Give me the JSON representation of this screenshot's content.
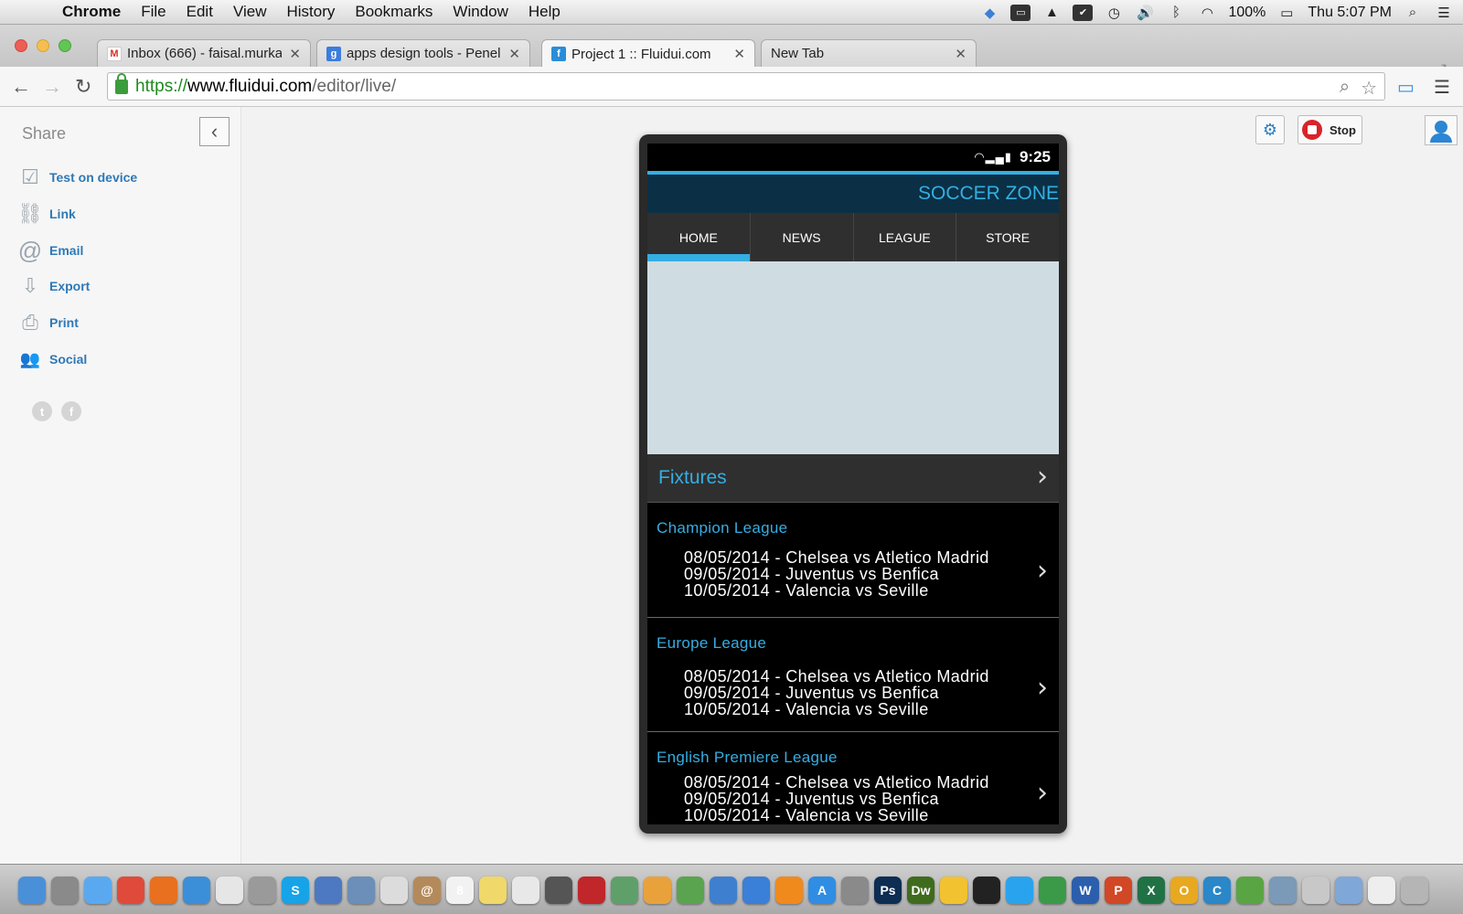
{
  "menubar": {
    "app_name": "Chrome",
    "menus": [
      "File",
      "Edit",
      "View",
      "History",
      "Bookmarks",
      "Window",
      "Help"
    ],
    "battery": "100%",
    "clock": "Thu 5:07 PM"
  },
  "tabs": [
    {
      "title": "Inbox (666) - faisal.murka",
      "favicon": "gmail-icon",
      "favicon_char": "M",
      "favicon_color": "#d93025"
    },
    {
      "title": "apps design tools - Penelu",
      "favicon": "google-icon",
      "favicon_char": "g",
      "favicon_color": "#3b7ddd"
    },
    {
      "title": "Project 1 :: Fluidui.com",
      "favicon": "fluidui-icon",
      "favicon_char": "f",
      "favicon_color": "#2a8dd8"
    },
    {
      "title": "New Tab",
      "favicon": "",
      "favicon_char": "",
      "favicon_color": ""
    }
  ],
  "address": {
    "scheme": "https://",
    "host": "www.fluidui.com",
    "path": "/editor/live/"
  },
  "share_panel": {
    "title": "Share",
    "items": [
      {
        "label": "Test on device",
        "icon": "checkbox-icon",
        "glyph": "☑"
      },
      {
        "label": "Link",
        "icon": "link-icon",
        "glyph": "⛓"
      },
      {
        "label": "Email",
        "icon": "at-icon",
        "glyph": "@"
      },
      {
        "label": "Export",
        "icon": "export-icon",
        "glyph": "⇩"
      },
      {
        "label": "Print",
        "icon": "printer-icon",
        "glyph": "⎙"
      },
      {
        "label": "Social",
        "icon": "people-icon",
        "glyph": "👥"
      }
    ],
    "social_twitter": "t",
    "social_facebook": "f"
  },
  "top_controls": {
    "stop_label": "Stop"
  },
  "phone": {
    "time": "9:25",
    "app_title": "SOCCER ZONE",
    "tabs": [
      "HOME",
      "NEWS",
      "LEAGUE",
      "STORE"
    ],
    "active_tab": "HOME",
    "fixtures_label": "Fixtures",
    "leagues": [
      {
        "title": "Champion League",
        "matches": [
          "08/05/2014 - Chelsea vs Atletico Madrid",
          "09/05/2014 - Juventus vs Benfica",
          "10/05/2014 - Valencia vs Seville"
        ]
      },
      {
        "title": "Europe League",
        "matches": [
          "08/05/2014 - Chelsea vs Atletico Madrid",
          "09/05/2014 - Juventus vs Benfica",
          "10/05/2014 - Valencia vs Seville"
        ]
      },
      {
        "title": "English Premiere League",
        "matches": [
          "08/05/2014 - Chelsea vs Atletico Madrid",
          "09/05/2014 - Juventus vs Benfica",
          "10/05/2014 - Valencia vs Seville"
        ]
      }
    ]
  },
  "colors": {
    "accent_blue": "#35aee2",
    "appbar_navy": "#0b3045",
    "link_blue": "#2f78b5",
    "stop_red": "#d9222a"
  },
  "dock": [
    {
      "name": "finder-icon",
      "color": "#4a90d9",
      "char": ""
    },
    {
      "name": "launchpad-icon",
      "color": "#8a8a8a",
      "char": ""
    },
    {
      "name": "messages-icon",
      "color": "#5aa9f0",
      "char": ""
    },
    {
      "name": "chrome-icon",
      "color": "#e04a3a",
      "char": ""
    },
    {
      "name": "firefox-icon",
      "color": "#e8701e",
      "char": ""
    },
    {
      "name": "safari-icon",
      "color": "#3b8fd9",
      "char": ""
    },
    {
      "name": "grid-app-icon",
      "color": "#e6e6e6",
      "char": ""
    },
    {
      "name": "system-prefs-icon",
      "color": "#9a9a9a",
      "char": ""
    },
    {
      "name": "skype-icon",
      "color": "#17a3e8",
      "char": "S"
    },
    {
      "name": "xcode-icon",
      "color": "#4c79c2",
      "char": ""
    },
    {
      "name": "preview-icon",
      "color": "#6b8fb8",
      "char": ""
    },
    {
      "name": "textedit-icon",
      "color": "#dcdcdc",
      "char": ""
    },
    {
      "name": "contacts-icon",
      "color": "#b58a5a",
      "char": "@"
    },
    {
      "name": "calendar-icon",
      "color": "#f2f2f2",
      "char": "8"
    },
    {
      "name": "notes-icon",
      "color": "#f0d86a",
      "char": ""
    },
    {
      "name": "reminders-icon",
      "color": "#e8e8e8",
      "char": ""
    },
    {
      "name": "facetime-icon",
      "color": "#555555",
      "char": ""
    },
    {
      "name": "photobooth-icon",
      "color": "#c0262a",
      "char": ""
    },
    {
      "name": "iphoto-icon",
      "color": "#5fa06a",
      "char": ""
    },
    {
      "name": "pages-icon",
      "color": "#e9a23b",
      "char": ""
    },
    {
      "name": "numbers-icon",
      "color": "#5aa44f",
      "char": ""
    },
    {
      "name": "keynote-icon",
      "color": "#3f7fcf",
      "char": ""
    },
    {
      "name": "itunes-icon",
      "color": "#3a7fd8",
      "char": ""
    },
    {
      "name": "ibooks-icon",
      "color": "#f08a1c",
      "char": ""
    },
    {
      "name": "appstore-icon",
      "color": "#2f8de4",
      "char": "A"
    },
    {
      "name": "settings-gear-icon",
      "color": "#8a8a8a",
      "char": ""
    },
    {
      "name": "photoshop-icon",
      "color": "#0d2d52",
      "char": "Ps"
    },
    {
      "name": "dreamweaver-icon",
      "color": "#3f6b1e",
      "char": "Dw"
    },
    {
      "name": "cyberduck-icon",
      "color": "#f2c230",
      "char": ""
    },
    {
      "name": "terminal-icon",
      "color": "#222222",
      "char": ""
    },
    {
      "name": "twitter-icon",
      "color": "#2aa3ef",
      "char": ""
    },
    {
      "name": "google-drive-icon",
      "color": "#3a9a48",
      "char": ""
    },
    {
      "name": "word-icon",
      "color": "#2b5fad",
      "char": "W"
    },
    {
      "name": "powerpoint-icon",
      "color": "#d24726",
      "char": "P"
    },
    {
      "name": "excel-icon",
      "color": "#207245",
      "char": "X"
    },
    {
      "name": "outlook-icon",
      "color": "#e8a820",
      "char": "O"
    },
    {
      "name": "c-app-icon",
      "color": "#2a87c8",
      "char": "C"
    },
    {
      "name": "messenger-icon",
      "color": "#59a544",
      "char": ""
    },
    {
      "name": "network-icon",
      "color": "#7a9ab8",
      "char": ""
    },
    {
      "name": "scissors-icon",
      "color": "#c8c8c8",
      "char": ""
    },
    {
      "name": "document-icon",
      "color": "#7fa7d8",
      "char": ""
    },
    {
      "name": "file-icon",
      "color": "#eeeeee",
      "char": ""
    },
    {
      "name": "trash-icon",
      "color": "#b5b5b5",
      "char": ""
    }
  ]
}
